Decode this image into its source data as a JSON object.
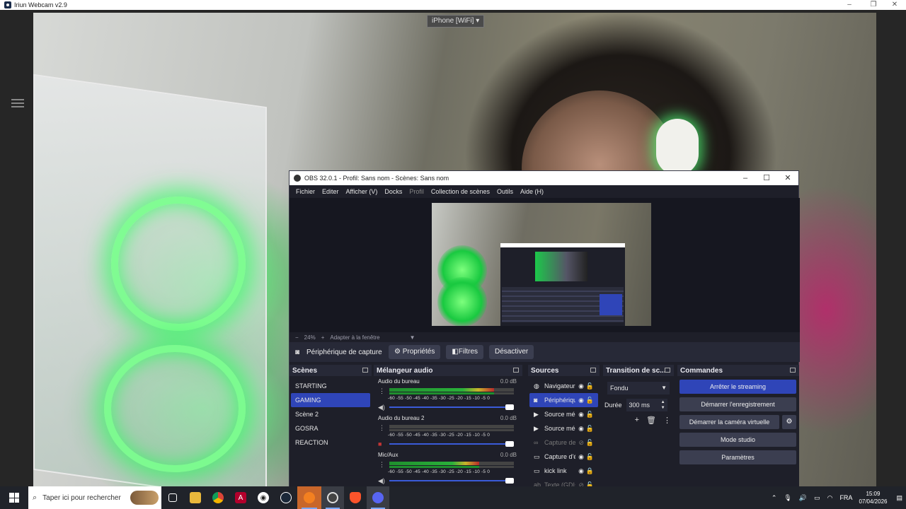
{
  "iriun": {
    "title": "Iriun Webcam v2.9",
    "device_select": "iPhone [WiFi]",
    "window_controls": [
      "–",
      "❐",
      "✕"
    ]
  },
  "obs": {
    "title": "OBS 32.0.1 - Profil: Sans nom - Scènes: Sans nom",
    "window_controls": [
      "–",
      "☐",
      "✕"
    ],
    "menu": [
      "Fichier",
      "Editer",
      "Afficher (V)",
      "Docks",
      "Profil",
      "Collection de scènes",
      "Outils",
      "Aide (H)"
    ],
    "zoom_bar": {
      "minus": "−",
      "zoom": "24%",
      "plus": "+",
      "fit": "Adapter à la fenêtre",
      "chevron": "▼"
    },
    "source_toolbar": {
      "source_name": "Périphérique de capture vidéo",
      "properties": "Propriétés",
      "filters": "Filtres",
      "deactivate": "Désactiver"
    },
    "scenes": {
      "title": "Scènes",
      "items": [
        "STARTING",
        "GAMING",
        "Scène 2",
        "GOSRA",
        "REACTION"
      ],
      "active_index": 1
    },
    "audio_mixer": {
      "title": "Mélangeur audio",
      "ticks": "-60 -55 -50 -45 -40 -35 -30 -25 -20 -15 -10 -5 0",
      "channels": [
        {
          "name": "Audio du bureau",
          "db": "0.0 dB",
          "level": 0.84,
          "muted": false
        },
        {
          "name": "Audio du bureau 2",
          "db": "0.0 dB",
          "level": 0.0,
          "muted": true
        },
        {
          "name": "Mic/Aux",
          "db": "0.0 dB",
          "level": 0.72,
          "muted": false
        }
      ]
    },
    "sources": {
      "title": "Sources",
      "items": [
        {
          "icon": "globe-icon",
          "name": "Navigateur",
          "visible": true,
          "locked": false,
          "dim": false
        },
        {
          "icon": "camera-icon",
          "name": "Périphérique",
          "visible": true,
          "locked": false,
          "dim": false
        },
        {
          "icon": "play-icon",
          "name": "Source média",
          "visible": true,
          "locked": false,
          "dim": false
        },
        {
          "icon": "play-icon",
          "name": "Source média",
          "visible": true,
          "locked": false,
          "dim": false
        },
        {
          "icon": "link-icon",
          "name": "Capture de",
          "visible": false,
          "locked": false,
          "dim": true
        },
        {
          "icon": "monitor-icon",
          "name": "Capture d'écran",
          "visible": true,
          "locked": false,
          "dim": false
        },
        {
          "icon": "monitor-icon",
          "name": "kick link",
          "visible": true,
          "locked": true,
          "dim": false
        },
        {
          "icon": "text-icon",
          "name": "Texte (GDI+)",
          "visible": false,
          "locked": false,
          "dim": true
        }
      ],
      "active_index": 1
    },
    "transition": {
      "title": "Transition de sc...",
      "type": "Fondu",
      "duration_label": "Durée",
      "duration_value": "300 ms"
    },
    "commands": {
      "title": "Commandes",
      "stop_streaming": "Arrêter le streaming",
      "start_recording": "Démarrer l'enregistrement",
      "start_virtual_cam": "Démarrer la caméra virtuelle",
      "studio_mode": "Mode studio",
      "settings": "Paramètres"
    }
  },
  "taskbar": {
    "search_placeholder": "Taper ici pour rechercher",
    "apps": [
      "task-view-icon",
      "file-explorer-icon",
      "chrome-icon",
      "adobe-icon",
      "obs-icon",
      "steam-icon",
      "cloudflare-icon",
      "obs-active-icon",
      "brave-icon",
      "discord-icon"
    ],
    "language": "FRA",
    "time": "15:09",
    "date": "07/04/2026"
  }
}
